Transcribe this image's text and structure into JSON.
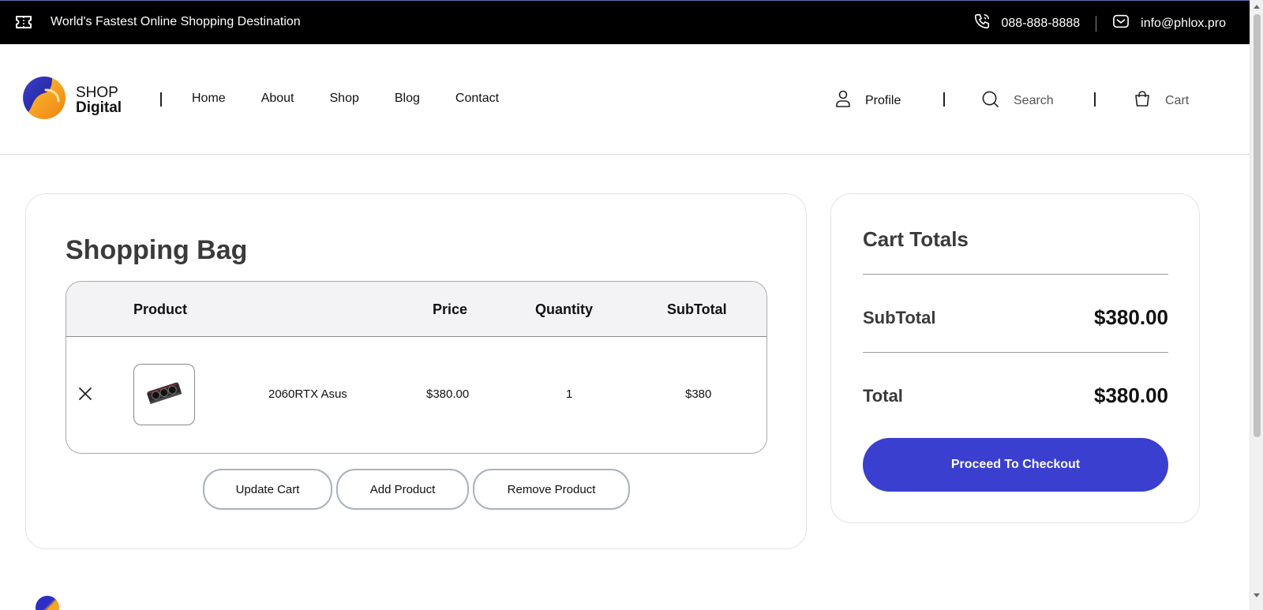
{
  "topbar": {
    "tagline": "World's Fastest Online Shopping Destination",
    "phone": "088-888-8888",
    "email": "info@phlox.pro"
  },
  "header": {
    "logo": {
      "line1": "SHOP",
      "line2": "Digital"
    },
    "nav": [
      "Home",
      "About",
      "Shop",
      "Blog",
      "Contact"
    ],
    "profile_label": "Profile",
    "search_label": "Search",
    "cart_label": "Cart"
  },
  "bag": {
    "title": "Shopping Bag",
    "columns": {
      "product": "Product",
      "price": "Price",
      "quantity": "Quantity",
      "subtotal": "SubTotal"
    },
    "rows": [
      {
        "name": "2060RTX Asus",
        "price": "$380.00",
        "quantity": "1",
        "subtotal": "$380"
      }
    ],
    "buttons": {
      "update": "Update Cart",
      "add": "Add Product",
      "remove": "Remove Product"
    }
  },
  "totals": {
    "title": "Cart Totals",
    "subtotal_label": "SubTotal",
    "subtotal_value": "$380.00",
    "total_label": "Total",
    "total_value": "$380.00",
    "checkout_label": "Proceed To Checkout"
  },
  "colors": {
    "accent": "#3a3fcf",
    "topbar": "#000000",
    "logo_blue": "#2b2fc5",
    "logo_orange": "#f5a623"
  }
}
